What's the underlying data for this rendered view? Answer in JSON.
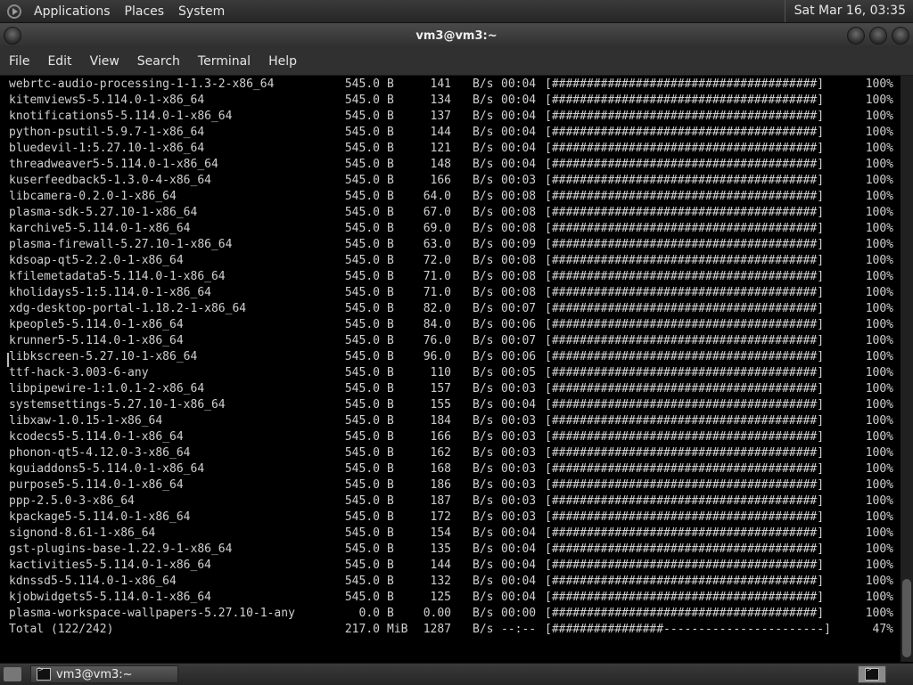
{
  "top_panel": {
    "menus": [
      "Applications",
      "Places",
      "System"
    ],
    "clock": "Sat Mar 16, 03:35"
  },
  "window": {
    "title": "vm3@vm3:~",
    "menubar": [
      "File",
      "Edit",
      "View",
      "Search",
      "Terminal",
      "Help"
    ]
  },
  "terminal": {
    "rows": [
      {
        "name": "webrtc-audio-processing-1-1.3-2-x86_64",
        "size": "545.0",
        "unit": "B",
        "rate": "141",
        "runit": "B/s",
        "eta": "00:04",
        "bar": "[######################################]",
        "pct": "100%"
      },
      {
        "name": "kitemviews5-5.114.0-1-x86_64",
        "size": "545.0",
        "unit": "B",
        "rate": "134",
        "runit": "B/s",
        "eta": "00:04",
        "bar": "[######################################]",
        "pct": "100%"
      },
      {
        "name": "knotifications5-5.114.0-1-x86_64",
        "size": "545.0",
        "unit": "B",
        "rate": "137",
        "runit": "B/s",
        "eta": "00:04",
        "bar": "[######################################]",
        "pct": "100%"
      },
      {
        "name": "python-psutil-5.9.7-1-x86_64",
        "size": "545.0",
        "unit": "B",
        "rate": "144",
        "runit": "B/s",
        "eta": "00:04",
        "bar": "[######################################]",
        "pct": "100%"
      },
      {
        "name": "bluedevil-1:5.27.10-1-x86_64",
        "size": "545.0",
        "unit": "B",
        "rate": "121",
        "runit": "B/s",
        "eta": "00:04",
        "bar": "[######################################]",
        "pct": "100%"
      },
      {
        "name": "threadweaver5-5.114.0-1-x86_64",
        "size": "545.0",
        "unit": "B",
        "rate": "148",
        "runit": "B/s",
        "eta": "00:04",
        "bar": "[######################################]",
        "pct": "100%"
      },
      {
        "name": "kuserfeedback5-1.3.0-4-x86_64",
        "size": "545.0",
        "unit": "B",
        "rate": "166",
        "runit": "B/s",
        "eta": "00:03",
        "bar": "[######################################]",
        "pct": "100%"
      },
      {
        "name": "libcamera-0.2.0-1-x86_64",
        "size": "545.0",
        "unit": "B",
        "rate": "64.0",
        "runit": "B/s",
        "eta": "00:08",
        "bar": "[######################################]",
        "pct": "100%"
      },
      {
        "name": "plasma-sdk-5.27.10-1-x86_64",
        "size": "545.0",
        "unit": "B",
        "rate": "67.0",
        "runit": "B/s",
        "eta": "00:08",
        "bar": "[######################################]",
        "pct": "100%"
      },
      {
        "name": "karchive5-5.114.0-1-x86_64",
        "size": "545.0",
        "unit": "B",
        "rate": "69.0",
        "runit": "B/s",
        "eta": "00:08",
        "bar": "[######################################]",
        "pct": "100%"
      },
      {
        "name": "plasma-firewall-5.27.10-1-x86_64",
        "size": "545.0",
        "unit": "B",
        "rate": "63.0",
        "runit": "B/s",
        "eta": "00:09",
        "bar": "[######################################]",
        "pct": "100%"
      },
      {
        "name": "kdsoap-qt5-2.2.0-1-x86_64",
        "size": "545.0",
        "unit": "B",
        "rate": "72.0",
        "runit": "B/s",
        "eta": "00:08",
        "bar": "[######################################]",
        "pct": "100%"
      },
      {
        "name": "kfilemetadata5-5.114.0-1-x86_64",
        "size": "545.0",
        "unit": "B",
        "rate": "71.0",
        "runit": "B/s",
        "eta": "00:08",
        "bar": "[######################################]",
        "pct": "100%"
      },
      {
        "name": "kholidays5-1:5.114.0-1-x86_64",
        "size": "545.0",
        "unit": "B",
        "rate": "71.0",
        "runit": "B/s",
        "eta": "00:08",
        "bar": "[######################################]",
        "pct": "100%"
      },
      {
        "name": "xdg-desktop-portal-1.18.2-1-x86_64",
        "size": "545.0",
        "unit": "B",
        "rate": "82.0",
        "runit": "B/s",
        "eta": "00:07",
        "bar": "[######################################]",
        "pct": "100%"
      },
      {
        "name": "kpeople5-5.114.0-1-x86_64",
        "size": "545.0",
        "unit": "B",
        "rate": "84.0",
        "runit": "B/s",
        "eta": "00:06",
        "bar": "[######################################]",
        "pct": "100%"
      },
      {
        "name": "krunner5-5.114.0-1-x86_64",
        "size": "545.0",
        "unit": "B",
        "rate": "76.0",
        "runit": "B/s",
        "eta": "00:07",
        "bar": "[######################################]",
        "pct": "100%"
      },
      {
        "name": "libkscreen-5.27.10-1-x86_64",
        "size": "545.0",
        "unit": "B",
        "rate": "96.0",
        "runit": "B/s",
        "eta": "00:06",
        "bar": "[######################################]",
        "pct": "100%"
      },
      {
        "name": "ttf-hack-3.003-6-any",
        "size": "545.0",
        "unit": "B",
        "rate": "110",
        "runit": "B/s",
        "eta": "00:05",
        "bar": "[######################################]",
        "pct": "100%"
      },
      {
        "name": "libpipewire-1:1.0.1-2-x86_64",
        "size": "545.0",
        "unit": "B",
        "rate": "157",
        "runit": "B/s",
        "eta": "00:03",
        "bar": "[######################################]",
        "pct": "100%"
      },
      {
        "name": "systemsettings-5.27.10-1-x86_64",
        "size": "545.0",
        "unit": "B",
        "rate": "155",
        "runit": "B/s",
        "eta": "00:04",
        "bar": "[######################################]",
        "pct": "100%"
      },
      {
        "name": "libxaw-1.0.15-1-x86_64",
        "size": "545.0",
        "unit": "B",
        "rate": "184",
        "runit": "B/s",
        "eta": "00:03",
        "bar": "[######################################]",
        "pct": "100%"
      },
      {
        "name": "kcodecs5-5.114.0-1-x86_64",
        "size": "545.0",
        "unit": "B",
        "rate": "166",
        "runit": "B/s",
        "eta": "00:03",
        "bar": "[######################################]",
        "pct": "100%"
      },
      {
        "name": "phonon-qt5-4.12.0-3-x86_64",
        "size": "545.0",
        "unit": "B",
        "rate": "162",
        "runit": "B/s",
        "eta": "00:03",
        "bar": "[######################################]",
        "pct": "100%"
      },
      {
        "name": "kguiaddons5-5.114.0-1-x86_64",
        "size": "545.0",
        "unit": "B",
        "rate": "168",
        "runit": "B/s",
        "eta": "00:03",
        "bar": "[######################################]",
        "pct": "100%"
      },
      {
        "name": "purpose5-5.114.0-1-x86_64",
        "size": "545.0",
        "unit": "B",
        "rate": "186",
        "runit": "B/s",
        "eta": "00:03",
        "bar": "[######################################]",
        "pct": "100%"
      },
      {
        "name": "ppp-2.5.0-3-x86_64",
        "size": "545.0",
        "unit": "B",
        "rate": "187",
        "runit": "B/s",
        "eta": "00:03",
        "bar": "[######################################]",
        "pct": "100%"
      },
      {
        "name": "kpackage5-5.114.0-1-x86_64",
        "size": "545.0",
        "unit": "B",
        "rate": "172",
        "runit": "B/s",
        "eta": "00:03",
        "bar": "[######################################]",
        "pct": "100%"
      },
      {
        "name": "signond-8.61-1-x86_64",
        "size": "545.0",
        "unit": "B",
        "rate": "154",
        "runit": "B/s",
        "eta": "00:04",
        "bar": "[######################################]",
        "pct": "100%"
      },
      {
        "name": "gst-plugins-base-1.22.9-1-x86_64",
        "size": "545.0",
        "unit": "B",
        "rate": "135",
        "runit": "B/s",
        "eta": "00:04",
        "bar": "[######################################]",
        "pct": "100%"
      },
      {
        "name": "kactivities5-5.114.0-1-x86_64",
        "size": "545.0",
        "unit": "B",
        "rate": "144",
        "runit": "B/s",
        "eta": "00:04",
        "bar": "[######################################]",
        "pct": "100%"
      },
      {
        "name": "kdnssd5-5.114.0-1-x86_64",
        "size": "545.0",
        "unit": "B",
        "rate": "132",
        "runit": "B/s",
        "eta": "00:04",
        "bar": "[######################################]",
        "pct": "100%"
      },
      {
        "name": "kjobwidgets5-5.114.0-1-x86_64",
        "size": "545.0",
        "unit": "B",
        "rate": "125",
        "runit": "B/s",
        "eta": "00:04",
        "bar": "[######################################]",
        "pct": "100%"
      },
      {
        "name": "plasma-workspace-wallpapers-5.27.10-1-any",
        "size": "0.0",
        "unit": "B",
        "rate": "0.00",
        "runit": "B/s",
        "eta": "00:00",
        "bar": "[######################################]",
        "pct": "100%"
      },
      {
        "name": "Total (122/242)",
        "size": "217.0",
        "unit": "MiB",
        "rate": "1287",
        "runit": "B/s",
        "eta": "--:--",
        "bar": "[################-----------------------]",
        "pct": "47%"
      }
    ]
  },
  "taskbar": {
    "window_button": "vm3@vm3:~"
  },
  "icons": {
    "menu_logo": "gnome-foot-icon",
    "taskbar_app": "terminal-icon",
    "workspace": "terminal-icon",
    "show_desktop": "desktop-icon"
  }
}
